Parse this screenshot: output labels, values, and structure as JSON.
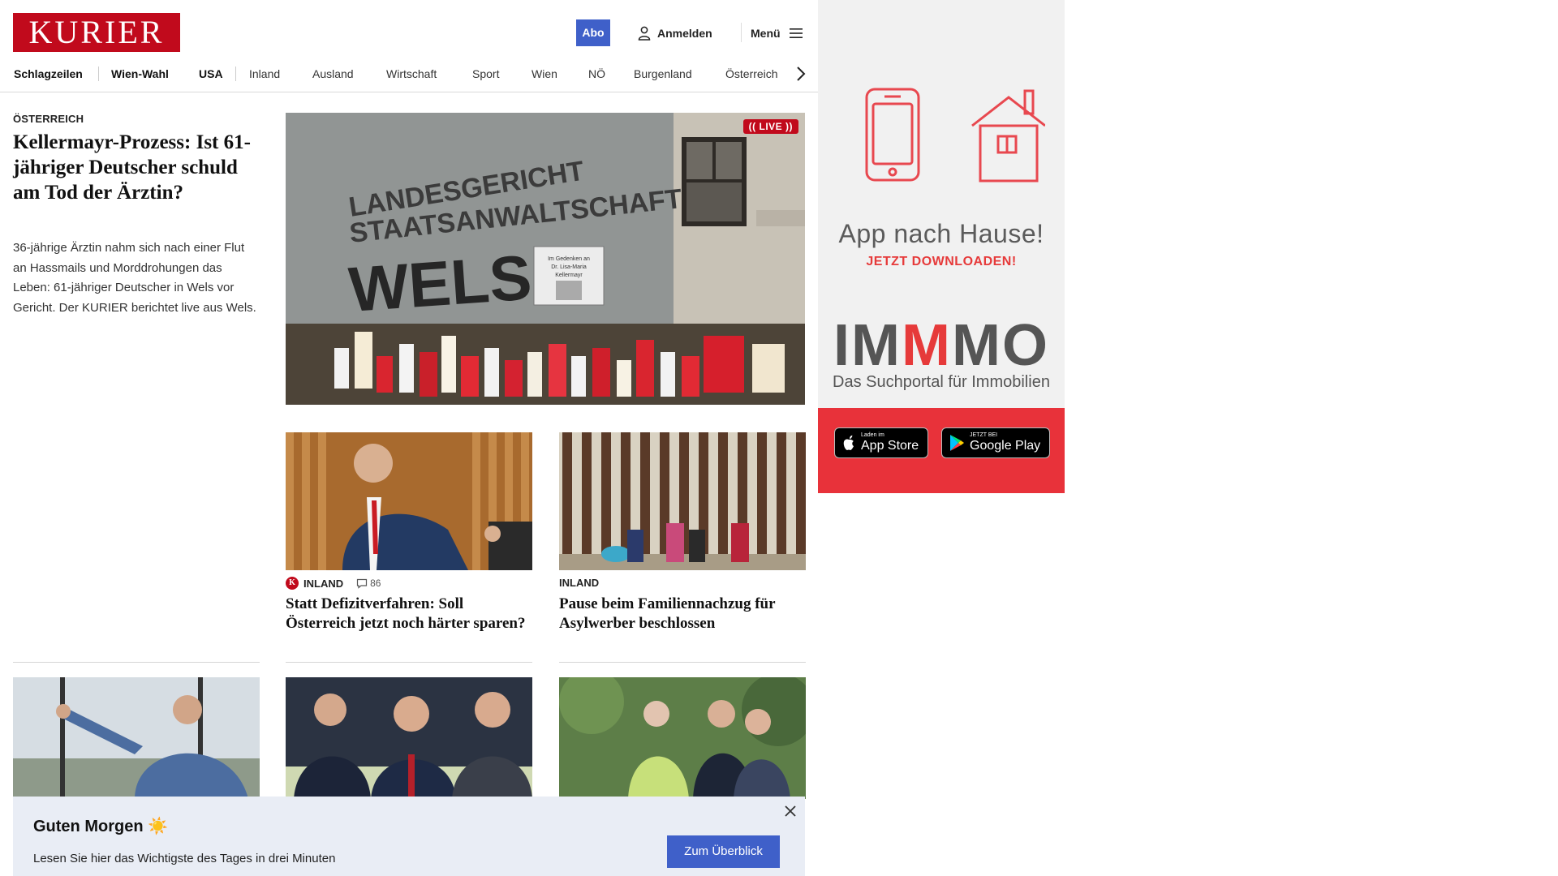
{
  "header": {
    "logo": "KURIER",
    "abo_label": "Abo",
    "login_label": "Anmelden",
    "menu_label": "Menü"
  },
  "nav": {
    "items": [
      "Schlagzeilen",
      "Wien-Wahl",
      "USA",
      "Inland",
      "Ausland",
      "Wirtschaft",
      "Sport",
      "Wien",
      "NÖ",
      "Burgenland",
      "Österreich"
    ]
  },
  "lead": {
    "kicker": "ÖSTERREICH",
    "title": "Kellermayr-Prozess: Ist 61-jähriger Deutscher schuld am Tod der Ärztin?",
    "text": "36-jährige Ärztin nahm sich nach einer Flut an Hassmails und Morddrohungen das Leben: 61-jähriger Deutscher in Wels vor Gericht. Der KURIER berichtet live aus Wels.",
    "live_label": "(( LIVE ))",
    "image_sign": [
      "LANDESGERICHT",
      "STAATSANWALTSCHAFT",
      "WELS"
    ],
    "image_poster": [
      "Im Gedenken an",
      "Dr. Lisa-Maria",
      "Kellermayr"
    ]
  },
  "stories": [
    {
      "kicker": "INLAND",
      "k_badge": "K",
      "comments": "86",
      "title": "Statt Defizitverfahren: Soll Österreich jetzt noch härter sparen?"
    },
    {
      "kicker": "INLAND",
      "title": "Pause beim Familiennachzug für Asylwerber beschlossen"
    }
  ],
  "banner": {
    "title": "Guten Morgen ☀️",
    "text": "Lesen Sie hier das Wichtigste des Tages in drei Minuten",
    "button": "Zum Überblick"
  },
  "ad": {
    "title": "App nach Hause!",
    "subtitle": "JETZT DOWNLOADEN!",
    "brand_a": "IM",
    "brand_b": "M",
    "brand_c": "MO",
    "tagline": "Das Suchportal für Immobilien",
    "appstore_small": "Laden im",
    "appstore_big": "App Store",
    "googleplay_small": "JETZT BEI",
    "googleplay_big": "Google Play"
  },
  "colors": {
    "brand_red": "#c10a1c",
    "button_blue": "#3f60c9",
    "ad_red": "#e8323a"
  }
}
